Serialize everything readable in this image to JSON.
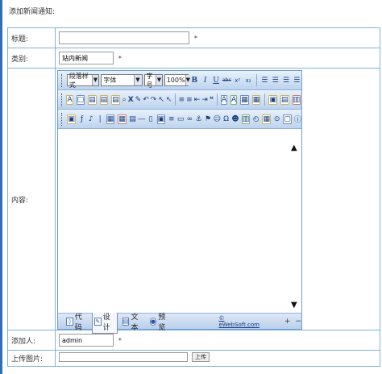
{
  "page": {
    "title": "添加新闻通知:"
  },
  "form": {
    "title_label": "标题:",
    "title_value": "",
    "title_required": "*",
    "category_label": "类别:",
    "category_value": "站内新闻",
    "category_required": "*",
    "content_label": "内容:",
    "adder_label": "添加人:",
    "adder_value": "admin",
    "adder_required": "*",
    "upload_label": "上传图片:",
    "upload_button": "上传"
  },
  "editor": {
    "toolbar1": {
      "paragraph_style": "段落样式",
      "font_name": "字体",
      "font_size": "字号",
      "zoom": "100%",
      "bold": "B",
      "italic": "I",
      "underline": "U",
      "strike": "abc",
      "superscript": "x²",
      "subscript": "x₂"
    },
    "toolbar2": {
      "cut": "X"
    },
    "status": {
      "code_mode": "代码",
      "design_mode": "设计",
      "text_mode": "文本",
      "preview_mode": "预览",
      "brand": "© eWebSoft.com",
      "zoom_in": "+",
      "zoom_out": "−"
    }
  },
  "colors": {
    "table_border": "#7fb3d9",
    "left_rule": "#2f6fb8",
    "toolbar_gradient_top": "#e9f1fb",
    "toolbar_gradient_bottom": "#bcd3ee"
  }
}
